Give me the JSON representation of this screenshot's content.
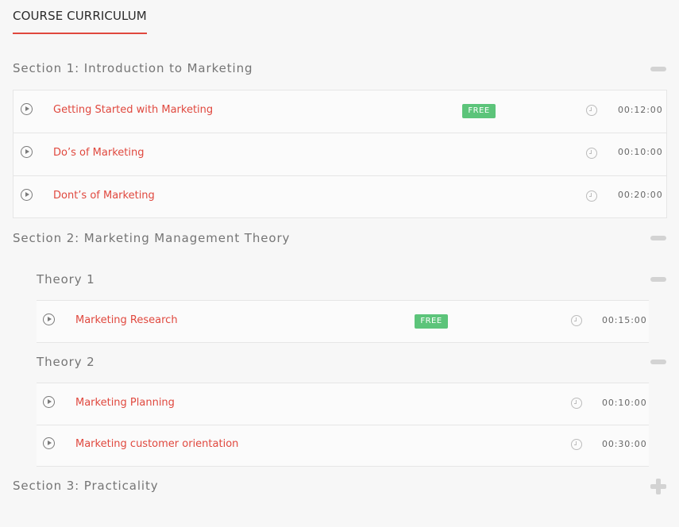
{
  "header": {
    "tab_label": "COURSE CURRICULUM"
  },
  "colors": {
    "accent": "#e0483e",
    "free_badge": "#5cc47a",
    "toggle": "#d3d3d3"
  },
  "icons": {
    "lesson": "play-circle-icon",
    "duration": "clock-icon",
    "expanded": "minus-icon",
    "collapsed": "plus-icon"
  },
  "sections": [
    {
      "title": "Section 1: Introduction to Marketing",
      "state": "expanded",
      "lessons": [
        {
          "title": "Getting Started with Marketing",
          "badge": "FREE",
          "duration": "00:12:00"
        },
        {
          "title": "Do’s of Marketing",
          "duration": "00:10:00"
        },
        {
          "title": "Dont’s of Marketing",
          "duration": "00:20:00"
        }
      ]
    },
    {
      "title": "Section 2: Marketing Management Theory",
      "state": "expanded",
      "subsections": [
        {
          "title": "Theory 1",
          "state": "expanded",
          "lessons": [
            {
              "title": "Marketing Research",
              "badge": "FREE",
              "duration": "00:15:00"
            }
          ]
        },
        {
          "title": "Theory 2",
          "state": "expanded",
          "lessons": [
            {
              "title": "Marketing Planning",
              "duration": "00:10:00"
            },
            {
              "title": "Marketing customer orientation",
              "duration": "00:30:00"
            }
          ]
        }
      ]
    },
    {
      "title": "Section 3: Practicality",
      "state": "collapsed"
    }
  ]
}
